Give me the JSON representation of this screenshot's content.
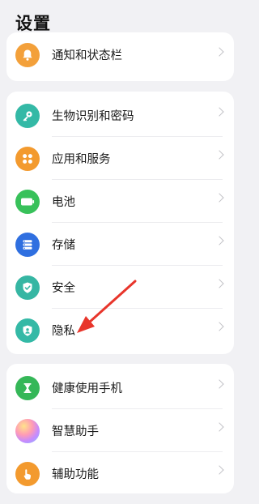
{
  "header": {
    "title": "设置"
  },
  "groups": [
    {
      "items": [
        {
          "label": "通知和状态栏",
          "color": "#f3a03a",
          "icon": "bell-icon"
        }
      ]
    },
    {
      "items": [
        {
          "label": "生物识别和密码",
          "color": "#34b9a6",
          "icon": "key-icon"
        },
        {
          "label": "应用和服务",
          "color": "#f39a2e",
          "icon": "apps-grid-icon"
        },
        {
          "label": "电池",
          "color": "#38c15a",
          "icon": "battery-icon"
        },
        {
          "label": "存储",
          "color": "#2f6fe0",
          "icon": "storage-icon"
        },
        {
          "label": "安全",
          "color": "#36b6a3",
          "icon": "shield-check-icon"
        },
        {
          "label": "隐私",
          "color": "#34b9a6",
          "icon": "privacy-shield-icon"
        }
      ]
    },
    {
      "items": [
        {
          "label": "健康使用手机",
          "color": "#35b758",
          "icon": "hourglass-icon"
        },
        {
          "label": "智慧助手",
          "color": "gradient",
          "icon": "assistant-orb-icon"
        },
        {
          "label": "辅助功能",
          "color": "#f39a2e",
          "icon": "hand-icon"
        }
      ]
    }
  ],
  "annotation": {
    "arrow_color": "#e8352b",
    "points_to": "隐私"
  }
}
